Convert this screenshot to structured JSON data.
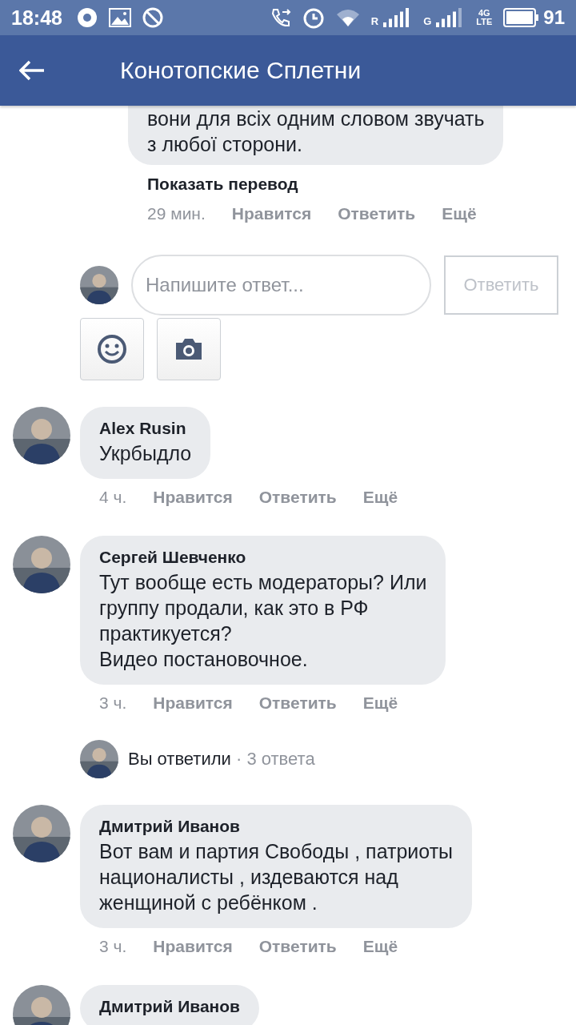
{
  "status_bar": {
    "time": "18:48",
    "sim_1": "R",
    "sim_2": "G",
    "network_top": "4G",
    "network_bottom": "LTE",
    "battery": "91"
  },
  "header": {
    "title": "Конотопские Сплетни"
  },
  "feed": [
    {
      "kind": "comment",
      "text": "вони для всіх одним словом звучать\nз любої сторони.",
      "translate": "Показать перевод",
      "time": "29 мин.",
      "actions": [
        "Нравится",
        "Ответить",
        "Ещё"
      ]
    },
    {
      "kind": "composer",
      "placeholder": "Напишите ответ...",
      "button": "Ответить",
      "button_disabled": true
    },
    {
      "kind": "comment",
      "name": "Alex Rusin",
      "text": "Укрбыдло",
      "time": "4 ч.",
      "actions": [
        "Нравится",
        "Ответить",
        "Ещё"
      ]
    },
    {
      "kind": "comment",
      "name": "Сергей Шевченко",
      "text": "Тут вообще есть модераторы? Или\nгруппу продали, как это в РФ\nпрактикуется?\nВидео постановочное.",
      "time": "3 ч.",
      "actions": [
        "Нравится",
        "Ответить",
        "Ещё"
      ]
    },
    {
      "kind": "replies",
      "label": "Вы ответили",
      "count": "· 3 ответа"
    },
    {
      "kind": "comment",
      "name": "Дмитрий Иванов",
      "text": "Вот вам и партия Свободы , патриоты\nнационалисты , издеваются над\nженщиной с ребёнком .",
      "time": "3 ч.",
      "actions": [
        "Нравится",
        "Ответить",
        "Ещё"
      ]
    },
    {
      "kind": "comment",
      "name": "Дмитрий Иванов"
    }
  ]
}
